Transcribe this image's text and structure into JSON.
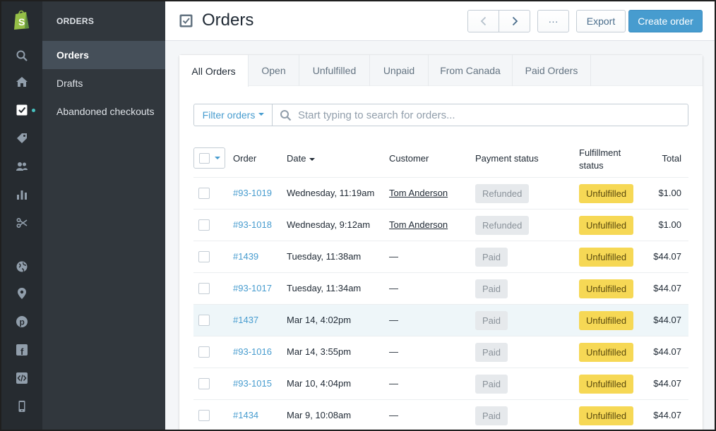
{
  "nav": {
    "icons": [
      "search-icon",
      "home-icon",
      "orders-icon",
      "products-tag-icon",
      "customers-icon",
      "analytics-icon",
      "discounts-icon",
      "online-store-globe-icon",
      "pos-location-icon",
      "pinterest-icon",
      "facebook-icon",
      "buy-button-code-icon",
      "mobile-icon"
    ],
    "section_header": "ORDERS",
    "items": [
      {
        "label": "Orders"
      },
      {
        "label": "Drafts"
      },
      {
        "label": "Abandoned checkouts"
      }
    ]
  },
  "header": {
    "title": "Orders",
    "more_label": "···",
    "export_label": "Export",
    "create_label": "Create order"
  },
  "tabs": [
    {
      "label": "All Orders"
    },
    {
      "label": "Open"
    },
    {
      "label": "Unfulfilled"
    },
    {
      "label": "Unpaid"
    },
    {
      "label": "From Canada"
    },
    {
      "label": "Paid Orders"
    }
  ],
  "filter": {
    "button_label": "Filter orders",
    "search_placeholder": "Start typing to search for orders..."
  },
  "table": {
    "headers": {
      "order": "Order",
      "date": "Date",
      "customer": "Customer",
      "payment": "Payment status",
      "fulfillment_1": "Fulfillment",
      "fulfillment_2": "status",
      "total": "Total"
    },
    "rows": [
      {
        "order": "#93-1019",
        "date": "Wednesday, 11:19am",
        "customer": "Tom Anderson",
        "payment": "Refunded",
        "fulfillment": "Unfulfilled",
        "total": "$1.00"
      },
      {
        "order": "#93-1018",
        "date": "Wednesday, 9:12am",
        "customer": "Tom Anderson",
        "payment": "Refunded",
        "fulfillment": "Unfulfilled",
        "total": "$1.00"
      },
      {
        "order": "#1439",
        "date": "Tuesday, 11:38am",
        "customer": "—",
        "payment": "Paid",
        "fulfillment": "Unfulfilled",
        "total": "$44.07"
      },
      {
        "order": "#93-1017",
        "date": "Tuesday, 11:34am",
        "customer": "—",
        "payment": "Paid",
        "fulfillment": "Unfulfilled",
        "total": "$44.07"
      },
      {
        "order": "#1437",
        "date": "Mar 14, 4:02pm",
        "customer": "—",
        "payment": "Paid",
        "fulfillment": "Unfulfilled",
        "total": "$44.07"
      },
      {
        "order": "#93-1016",
        "date": "Mar 14, 3:55pm",
        "customer": "—",
        "payment": "Paid",
        "fulfillment": "Unfulfilled",
        "total": "$44.07"
      },
      {
        "order": "#93-1015",
        "date": "Mar 10, 4:04pm",
        "customer": "—",
        "payment": "Paid",
        "fulfillment": "Unfulfilled",
        "total": "$44.07"
      },
      {
        "order": "#1434",
        "date": "Mar 9, 10:08am",
        "customer": "—",
        "payment": "Paid",
        "fulfillment": "Unfulfilled",
        "total": "$44.07"
      }
    ]
  },
  "colors": {
    "accent": "#479ccf",
    "rail": "#262b30",
    "subnav": "#31373d",
    "unfulfilled_badge": "#f6d855",
    "payment_badge": "#e6e9ec",
    "highlight_row": "#eef6f9"
  }
}
